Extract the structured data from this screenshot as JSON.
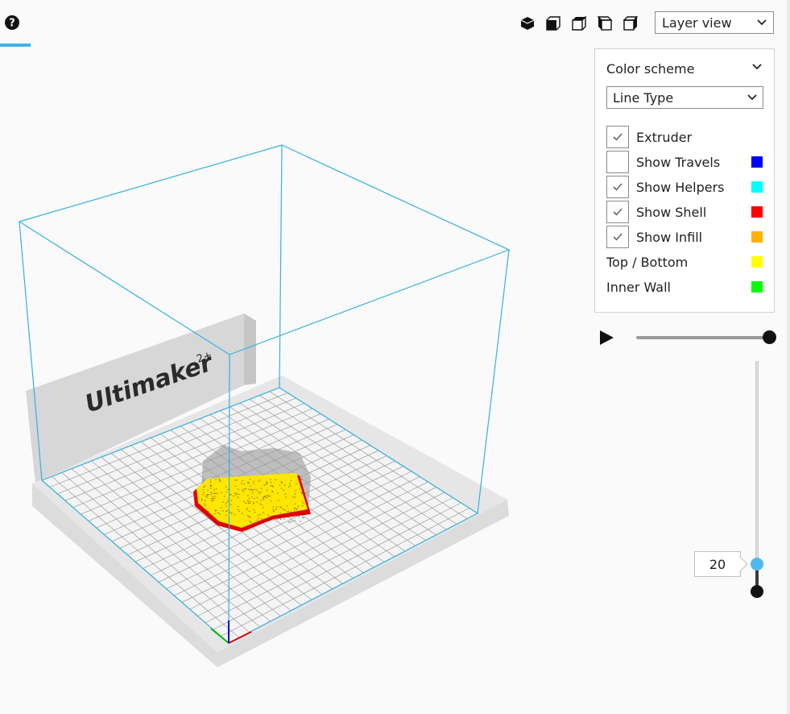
{
  "toolbar": {
    "view_mode": "Layer view",
    "camera_views": [
      {
        "name": "3d-view-icon"
      },
      {
        "name": "front-view-icon"
      },
      {
        "name": "top-view-icon"
      },
      {
        "name": "left-view-icon"
      },
      {
        "name": "right-view-icon"
      }
    ]
  },
  "panel": {
    "title": "Color scheme",
    "color_scheme": "Line Type",
    "items": [
      {
        "label": "Extruder",
        "checked": true,
        "color": null
      },
      {
        "label": "Show Travels",
        "checked": false,
        "color": "#0000ff"
      },
      {
        "label": "Show Helpers",
        "checked": true,
        "color": "#00ffff"
      },
      {
        "label": "Show Shell",
        "checked": true,
        "color": "#ff0000"
      },
      {
        "label": "Show Infill",
        "checked": true,
        "color": "#ffb300"
      },
      {
        "label": "Top / Bottom",
        "checked": null,
        "color": "#ffff00"
      },
      {
        "label": "Inner Wall",
        "checked": null,
        "color": "#00ff00"
      }
    ]
  },
  "layers": {
    "current": "20",
    "playback_progress": 1.0
  },
  "scene": {
    "brand_text": "Ultimaker",
    "brand_suffix": "2+"
  }
}
